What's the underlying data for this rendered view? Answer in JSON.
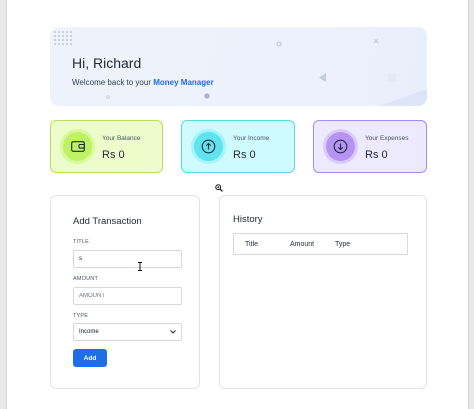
{
  "banner": {
    "greeting": "Hi, Richard",
    "welcome_prefix": "Welcome back to your ",
    "brand": "Money Manager"
  },
  "cards": {
    "balance": {
      "label": "Your Balance",
      "value": "Rs 0",
      "icon": "wallet-icon"
    },
    "income": {
      "label": "Your Income",
      "value": "Rs 0",
      "icon": "income-coin-icon"
    },
    "expense": {
      "label": "Your Expenses",
      "value": "Rs 0",
      "icon": "expense-coin-icon"
    }
  },
  "add_transaction": {
    "title": "Add Transaction",
    "title_field": {
      "label": "TITLE",
      "value": "s"
    },
    "amount_field": {
      "label": "AMOUNT",
      "placeholder": "AMOUNT",
      "value": ""
    },
    "type_field": {
      "label": "TYPE",
      "selected": "Income"
    },
    "add_label": "Add"
  },
  "history": {
    "title": "History",
    "columns": [
      "Title",
      "Amount",
      "Type"
    ]
  },
  "colors": {
    "accent": "#1e6fe6",
    "balance_bg": "#ecfccb",
    "income_bg": "#cffafe",
    "expense_bg": "#ede9fe"
  }
}
